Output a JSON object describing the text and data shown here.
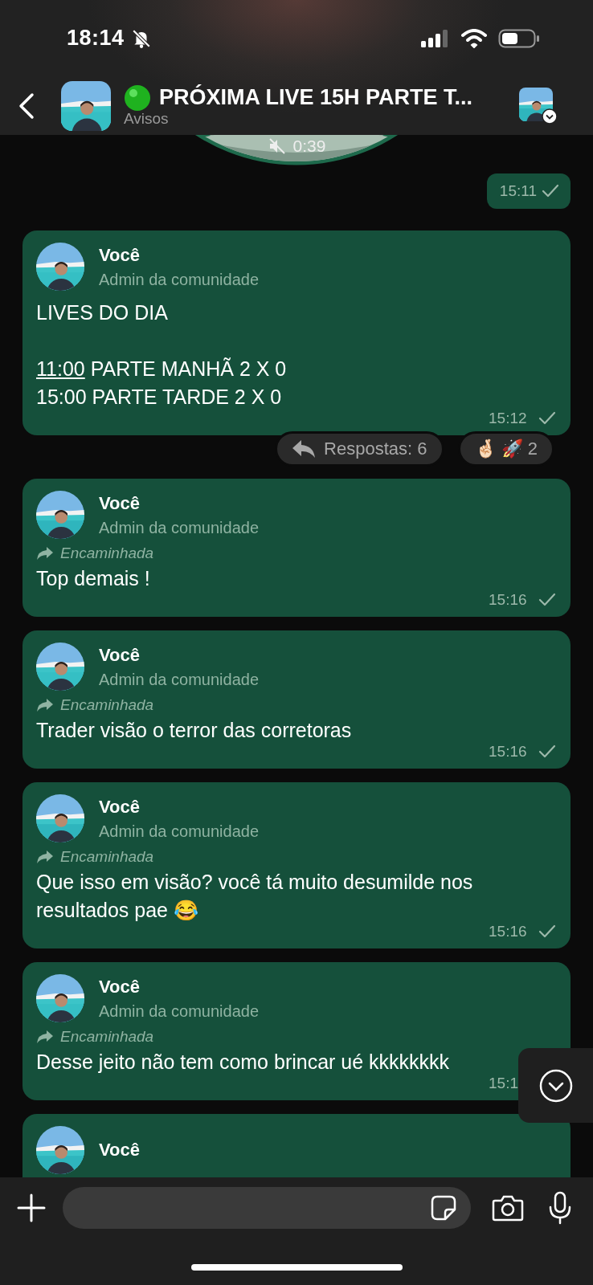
{
  "status_bar": {
    "time": "18:14"
  },
  "header": {
    "title": "PRÓXIMA LIVE 15H PARTE T...",
    "subtitle": "Avisos"
  },
  "video_note": {
    "duration": "0:39"
  },
  "time_bubble": {
    "time": "15:11",
    "tick": true
  },
  "messages": [
    {
      "sender": "Você",
      "role": "Admin da comunidade",
      "paragraphs": [
        [
          {
            "text": "LIVES DO DIA"
          }
        ],
        [
          {
            "link": "11:00"
          },
          {
            "text": " PARTE MANHÃ 2 X 0\n15:00 PARTE TARDE 2 X 0"
          }
        ]
      ],
      "time": "15:12",
      "tick": true,
      "replies": {
        "label": "Respostas: 6"
      },
      "reactions": {
        "emojis": "🤞🏻 🚀",
        "count": "2"
      }
    },
    {
      "sender": "Você",
      "role": "Admin da comunidade",
      "forwarded_label": "Encaminhada",
      "paragraphs": [
        [
          {
            "text": "Top demais !"
          }
        ]
      ],
      "time": "15:16",
      "tick": true
    },
    {
      "sender": "Você",
      "role": "Admin da comunidade",
      "forwarded_label": "Encaminhada",
      "paragraphs": [
        [
          {
            "text": "Trader visão o terror das corretoras"
          }
        ]
      ],
      "time": "15:16",
      "tick": true
    },
    {
      "sender": "Você",
      "role": "Admin da comunidade",
      "forwarded_label": "Encaminhada",
      "paragraphs": [
        [
          {
            "text": "Que isso em visão? você tá muito desumilde nos resultados pae 😂"
          }
        ]
      ],
      "time": "15:16",
      "tick": true
    },
    {
      "sender": "Você",
      "role": "Admin da comunidade",
      "forwarded_label": "Encaminhada",
      "paragraphs": [
        [
          {
            "text": "Desse jeito não tem como brincar ué kkkkkkkk"
          }
        ]
      ],
      "time": "15:1"
    },
    {
      "sender": "Você"
    }
  ]
}
